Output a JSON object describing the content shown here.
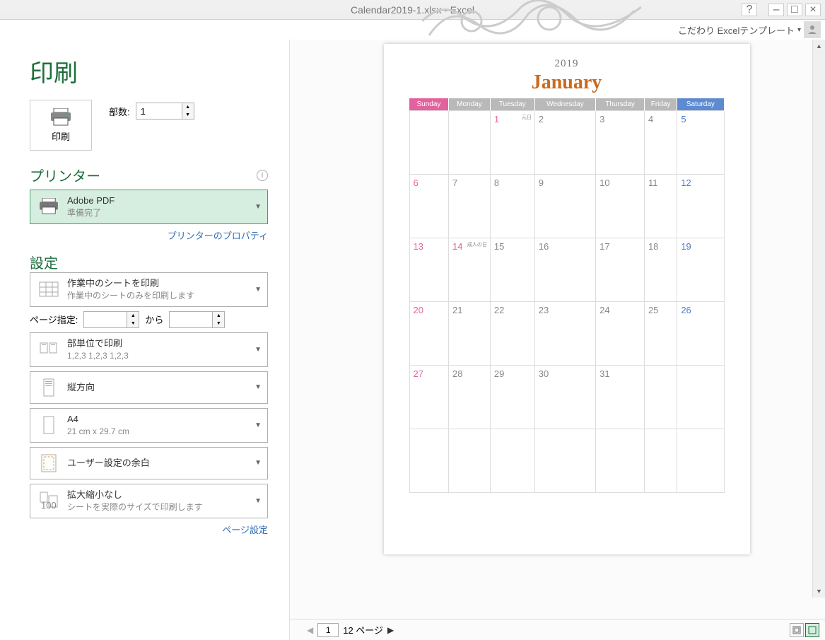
{
  "titlebar": {
    "title": "Calendar2019-1.xlsx - Excel",
    "help": "?"
  },
  "account": {
    "name": "こだわり Excelテンプレート"
  },
  "page": {
    "title": "印刷"
  },
  "print": {
    "button": "印刷",
    "copies_label": "部数:",
    "copies": "1"
  },
  "printer": {
    "section": "プリンター",
    "name": "Adobe PDF",
    "status": "準備完了",
    "properties": "プリンターのプロパティ"
  },
  "settings": {
    "section": "設定",
    "what": {
      "ln1": "作業中のシートを印刷",
      "ln2": "作業中のシートのみを印刷します"
    },
    "range": {
      "label": "ページ指定:",
      "from": "",
      "to_label": "から",
      "to": ""
    },
    "collate": {
      "ln1": "部単位で印刷",
      "ln2": "1,2,3    1,2,3    1,2,3"
    },
    "orient": {
      "ln1": "縦方向"
    },
    "paper": {
      "ln1": "A4",
      "ln2": "21 cm x 29.7 cm"
    },
    "margins": {
      "ln1": "ユーザー設定の余白"
    },
    "scale": {
      "ln1": "拡大縮小なし",
      "ln2": "シートを実際のサイズで印刷します"
    },
    "page_setup": "ページ設定"
  },
  "preview": {
    "year": "2019",
    "month": "January",
    "days": [
      "Sunday",
      "Monday",
      "Tuesday",
      "Wednesday",
      "Thursday",
      "Friday",
      "Saturday"
    ],
    "grid": [
      [
        null,
        null,
        {
          "d": "1",
          "hol": "元日"
        },
        {
          "d": "2"
        },
        {
          "d": "3"
        },
        {
          "d": "4"
        },
        {
          "d": "5"
        }
      ],
      [
        {
          "d": "6"
        },
        {
          "d": "7"
        },
        {
          "d": "8"
        },
        {
          "d": "9"
        },
        {
          "d": "10"
        },
        {
          "d": "11"
        },
        {
          "d": "12"
        }
      ],
      [
        {
          "d": "13"
        },
        {
          "d": "14",
          "hol": "成人の日"
        },
        {
          "d": "15"
        },
        {
          "d": "16"
        },
        {
          "d": "17"
        },
        {
          "d": "18"
        },
        {
          "d": "19"
        }
      ],
      [
        {
          "d": "20"
        },
        {
          "d": "21"
        },
        {
          "d": "22"
        },
        {
          "d": "23"
        },
        {
          "d": "24"
        },
        {
          "d": "25"
        },
        {
          "d": "26"
        }
      ],
      [
        {
          "d": "27"
        },
        {
          "d": "28"
        },
        {
          "d": "29"
        },
        {
          "d": "30"
        },
        {
          "d": "31"
        },
        null,
        null
      ],
      [
        null,
        null,
        null,
        null,
        null,
        null,
        null
      ]
    ]
  },
  "pager": {
    "current": "1",
    "total": "12 ページ"
  }
}
